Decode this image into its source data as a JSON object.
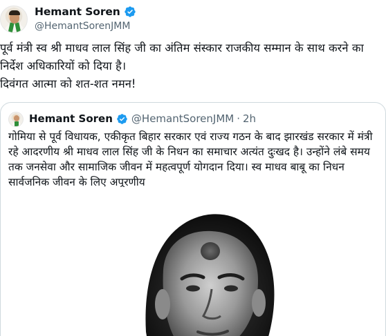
{
  "tweet": {
    "author": {
      "display_name": "Hemant Soren",
      "handle": "@HemantSorenJMM",
      "verified_icon": "verified-badge-icon"
    },
    "text_lines": [
      "पूर्व मंत्री स्व श्री माधव लाल सिंह जी का अंतिम संस्कार राजकीय सम्मान के साथ करने का",
      "निर्देश अधिकारियों को दिया है।",
      "दिवंगत आत्मा को शत-शत नमन!"
    ]
  },
  "quoted_tweet": {
    "author": {
      "display_name": "Hemant Soren",
      "handle": "@HemantSorenJMM",
      "separator": "·",
      "time": "2h"
    },
    "text_lines": [
      "गोमिया से पूर्व विधायक, एकीकृत बिहार सरकार एवं राज्य गठन के बाद झारखंड सरकार में मंत्री",
      "रहे आदरणीय श्री माधव लाल सिंह जी के निधन का समाचार अत्यंत दुःखद है। उन्होंने लंबे समय",
      "तक जनसेवा और सामाजिक जीवन में महत्वपूर्ण योगदान दिया। स्व माधव बाबू का निधन",
      "सार्वजनिक जीवन के लिए अपूरणीय"
    ],
    "media": {
      "type": "black-and-white portrait photo"
    }
  },
  "colors": {
    "text_primary": "#0f1419",
    "text_secondary": "#536471",
    "verified_blue": "#1d9bf0",
    "card_border": "#cfd9de"
  }
}
